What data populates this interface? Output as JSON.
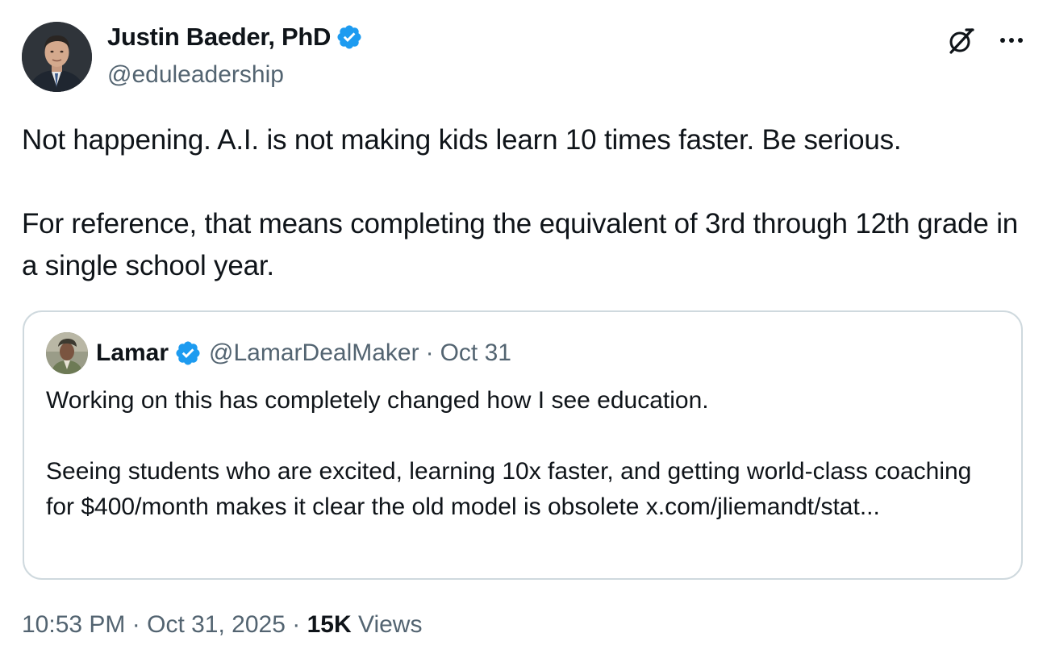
{
  "author": {
    "name": "Justin Baeder, PhD",
    "handle": "@eduleadership",
    "avatar_icon": "profile-photo",
    "verified_icon": "verified-badge-icon",
    "verified_color": "#1d9bf0"
  },
  "header_icons": [
    "grok-icon",
    "more-options-icon"
  ],
  "tweet": {
    "paragraphs": [
      "Not happening. A.I. is not making kids learn 10 times faster. Be serious.",
      "For reference, that means completing the equivalent of 3rd through 12th grade in a single school year."
    ]
  },
  "quoted": {
    "name": "Lamar",
    "handle": "@LamarDealMaker",
    "separator": "·",
    "date": "Oct 31",
    "paragraphs": [
      "Working on this has completely changed how I see education.",
      "Seeing students who are excited, learning 10x faster, and getting world-class coaching for $400/month makes it clear the old model is obsolete x.com/jliemandt/stat..."
    ]
  },
  "meta": {
    "time": "10:53 PM",
    "sep1": "·",
    "date": "Oct 31, 2025",
    "sep2": "·",
    "views_count": "15K",
    "views_label": "Views"
  },
  "colors": {
    "text": "#0f1419",
    "secondary": "#536471",
    "border": "#cfd9de",
    "accent": "#1d9bf0"
  }
}
